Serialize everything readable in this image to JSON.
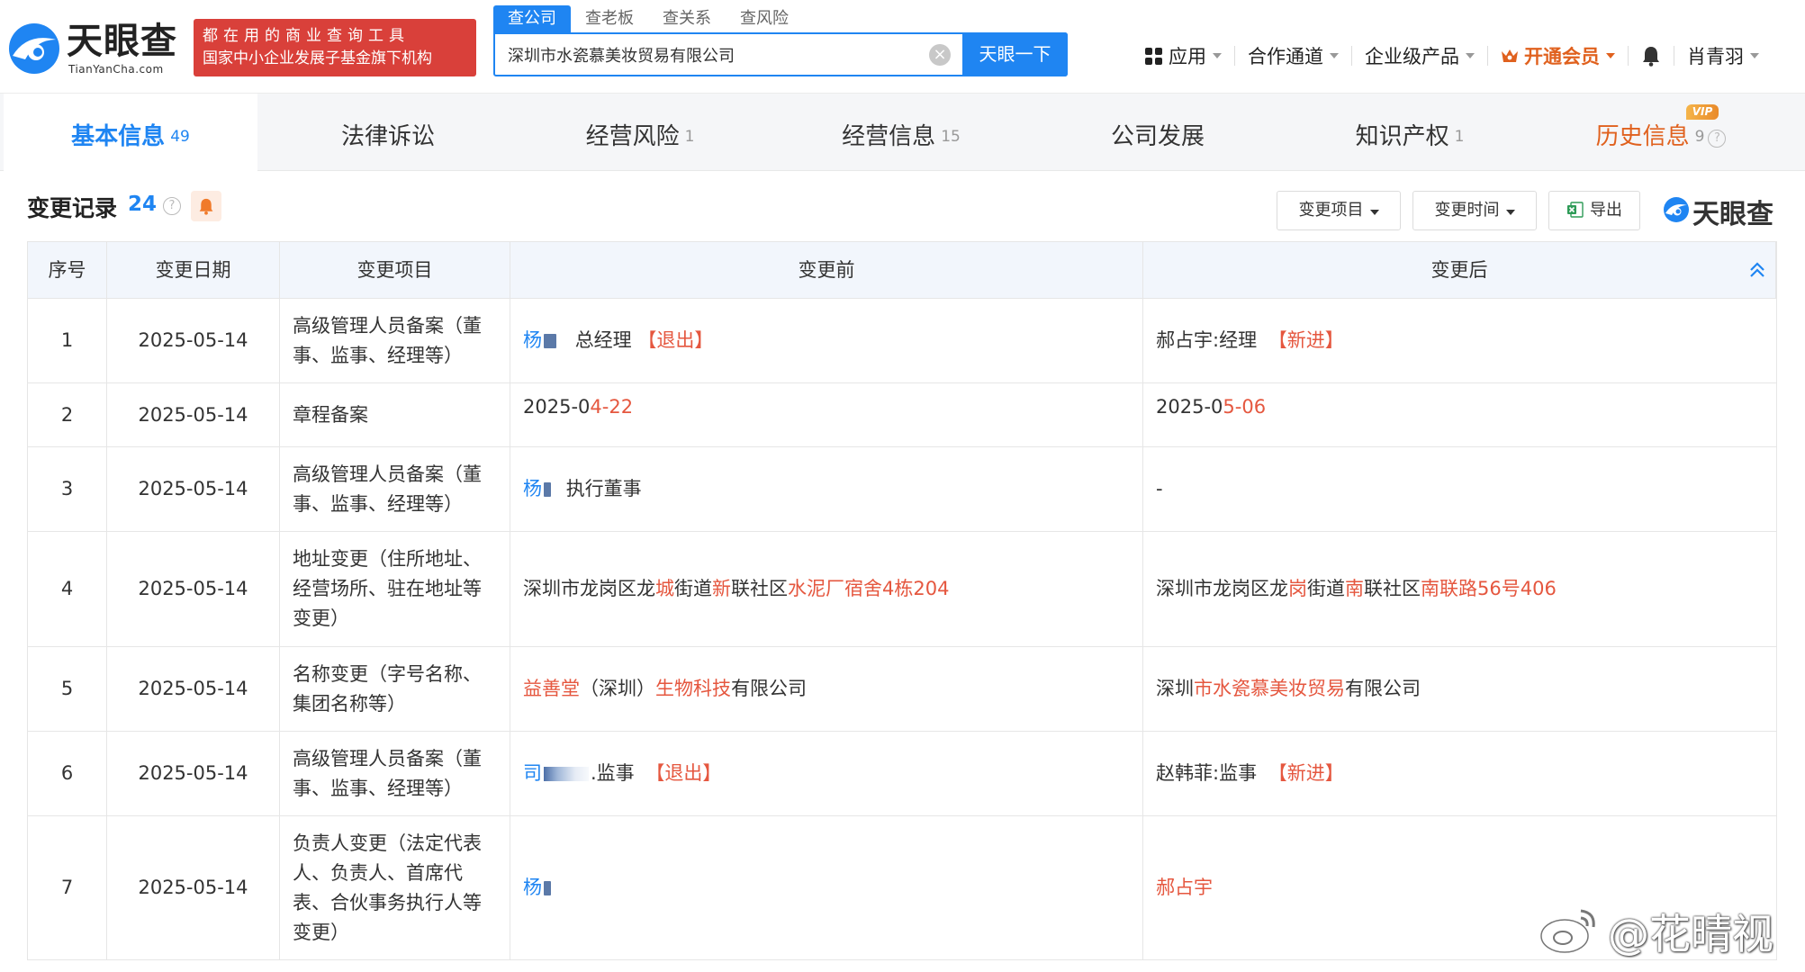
{
  "header": {
    "logo_text": "天眼查",
    "logo_sub": "TianYanCha.com",
    "slogan_line1": "都在用的商业查询工具",
    "slogan_line2": "国家中小企业发展子基金旗下机构",
    "search_tabs": [
      {
        "label": "查公司",
        "active": true
      },
      {
        "label": "查老板",
        "active": false
      },
      {
        "label": "查关系",
        "active": false
      },
      {
        "label": "查风险",
        "active": false
      }
    ],
    "search_value": "深圳市水瓷慕美妆贸易有限公司",
    "search_button": "天眼一下",
    "nav": {
      "apps": "应用",
      "partner": "合作通道",
      "enterprise": "企业级产品",
      "vip": "开通会员",
      "user": "肖青羽"
    }
  },
  "tabs": [
    {
      "label": "基本信息",
      "count": "49"
    },
    {
      "label": "法律诉讼",
      "count": ""
    },
    {
      "label": "经营风险",
      "count": "1"
    },
    {
      "label": "经营信息",
      "count": "15"
    },
    {
      "label": "公司发展",
      "count": ""
    },
    {
      "label": "知识产权",
      "count": "1"
    },
    {
      "label": "历史信息",
      "count": "9"
    }
  ],
  "vip_badge": "VIP",
  "section": {
    "title": "变更记录",
    "count": "24",
    "filter_item": "变更项目",
    "filter_time": "变更时间",
    "export": "导出",
    "brand": "天眼查"
  },
  "table": {
    "columns": [
      "序号",
      "变更日期",
      "变更项目",
      "变更前",
      "变更后"
    ],
    "rows": [
      {
        "idx": "1",
        "date": "2025-05-14",
        "item": "高级管理人员备案（董事、监事、经理等）"
      },
      {
        "idx": "2",
        "date": "2025-05-14",
        "item": "章程备案"
      },
      {
        "idx": "3",
        "date": "2025-05-14",
        "item": "高级管理人员备案（董事、监事、经理等）"
      },
      {
        "idx": "4",
        "date": "2025-05-14",
        "item": "地址变更（住所地址、经营场所、驻在地址等变更）"
      },
      {
        "idx": "5",
        "date": "2025-05-14",
        "item": "名称变更（字号名称、集团名称等）"
      },
      {
        "idx": "6",
        "date": "2025-05-14",
        "item": "高级管理人员备案（董事、监事、经理等）"
      },
      {
        "idx": "7",
        "date": "2025-05-14",
        "item": "负责人变更（法定代表人、负责人、首席代表、合伙事务执行人等变更）"
      }
    ],
    "r1": {
      "before_name": "杨",
      "before_role": "总经理",
      "before_tag": "【退出】",
      "after_text": "郝占宇:经理",
      "after_tag": "【新进】"
    },
    "r2": {
      "before_a": "2025-0",
      "before_b": "4-22",
      "after_a": "2025-0",
      "after_b": "5-06"
    },
    "r3": {
      "before_name": "杨",
      "before_role": "执行董事",
      "after_text": "-"
    },
    "r4": {
      "before": [
        "深圳市龙岗区龙",
        "城",
        "街道",
        "新",
        "联社区",
        "水泥厂宿舍4栋204"
      ],
      "after": [
        "深圳市龙岗区龙",
        "岗",
        "街道",
        "南",
        "联社区",
        "南联路56号406"
      ]
    },
    "r5": {
      "before": [
        "益善堂",
        "（深圳）",
        "生物科技",
        "有限公司"
      ],
      "after": [
        "深圳",
        "市水瓷慕美妆贸易",
        "有限公司"
      ]
    },
    "r6": {
      "before_name": "司",
      "before_role": ".监事",
      "before_tag": "【退出】",
      "after_text": "赵韩菲:监事",
      "after_tag": "【新进】"
    },
    "r7": {
      "before_name": "杨",
      "after_name": "郝占宇"
    }
  },
  "watermark": "@花晴视",
  "colors": {
    "primary": "#1f85f2",
    "accent": "#e5573f",
    "slogan_bg": "#d9403a",
    "vip": "#e0611e"
  }
}
